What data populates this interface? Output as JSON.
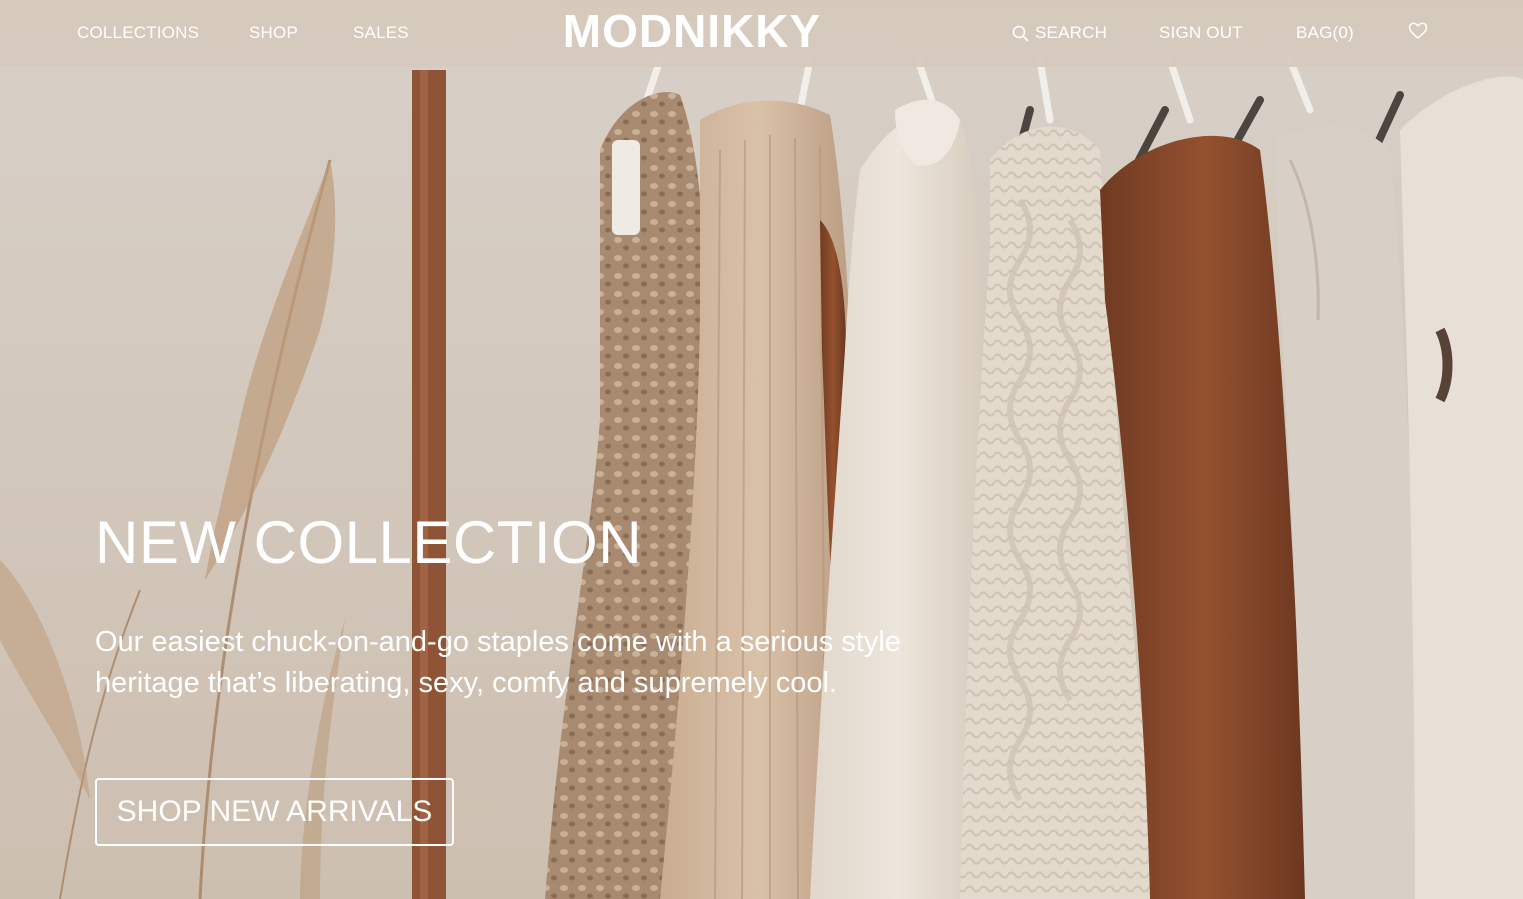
{
  "header": {
    "nav_left": [
      "COLLECTIONS",
      "SHOP",
      "SALES"
    ],
    "logo": "MODNIKKY",
    "search": "SEARCH",
    "sign_out": "SIGN OUT",
    "bag": "BAG(0)"
  },
  "hero": {
    "title": "NEW COLLECTION",
    "text": "Our easiest chuck-on-and-go staples come with a serious style heritage that’s liberating, sexy, comfy and supremely cool.",
    "cta": "SHOP NEW ARRIVALS"
  },
  "colors": {
    "header_bg": "#d6c9bc",
    "text": "#ffffff",
    "rust": "#8a4a2a",
    "cream": "#e9e1d6"
  },
  "icons": {
    "search": "search-icon",
    "wishlist": "heart-icon"
  }
}
